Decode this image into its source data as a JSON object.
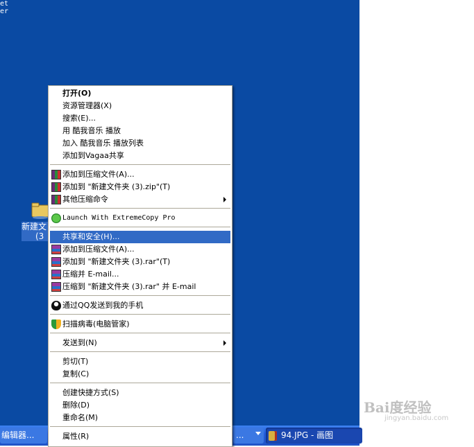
{
  "desktop": {
    "corner_text": "et\ner",
    "icon_label_line1": "新建文",
    "icon_label_line2": "(3"
  },
  "taskbar": {
    "button1_label": "编辑器...",
    "button2_label": "...",
    "active_task_label": "94.JPG - 画图",
    "active_task_icon": "paint-icon"
  },
  "context_menu": {
    "items": [
      {
        "label": "打开(O)",
        "bold": true
      },
      {
        "label": "资源管理器(X)"
      },
      {
        "label": "搜索(E)..."
      },
      {
        "label": "用 酷我音乐 播放"
      },
      {
        "label": "加入 酷我音乐 播放列表"
      },
      {
        "label": "添加到Vagaa共享"
      },
      {
        "label": "添加到压缩文件(A)...",
        "icon": "winrar-icon"
      },
      {
        "label": "添加到 \"新建文件夹 (3).zip\"(T)",
        "icon": "winrar-icon"
      },
      {
        "label": "其他压缩命令",
        "icon": "winrar-icon",
        "submenu": true
      },
      {
        "label": "Launch With ExtremeCopy Pro",
        "icon": "extremecopy-icon"
      },
      {
        "label": "共享和安全(H)...",
        "highlighted": true
      },
      {
        "label": "添加到压缩文件(A)...",
        "icon": "winrar-icon"
      },
      {
        "label": "添加到 \"新建文件夹 (3).rar\"(T)",
        "icon": "winrar-icon"
      },
      {
        "label": "压缩并 E-mail...",
        "icon": "winrar-icon"
      },
      {
        "label": "压缩到 \"新建文件夹 (3).rar\" 并 E-mail",
        "icon": "winrar-icon"
      },
      {
        "label": "通过QQ发送到我的手机",
        "icon": "qq-icon"
      },
      {
        "label": "扫描病毒(电脑管家)",
        "icon": "shield-icon"
      },
      {
        "label": "发送到(N)",
        "submenu": true
      },
      {
        "label": "剪切(T)"
      },
      {
        "label": "复制(C)"
      },
      {
        "label": "创建快捷方式(S)"
      },
      {
        "label": "删除(D)"
      },
      {
        "label": "重命名(M)"
      },
      {
        "label": "属性(R)"
      }
    ]
  },
  "watermark": {
    "text": "Bai度经验",
    "subtext": "jingyan.baidu.com"
  },
  "colors": {
    "desktop_bg": "#0a4aa3",
    "highlight": "#316ac5",
    "menu_border": "#aca899"
  }
}
